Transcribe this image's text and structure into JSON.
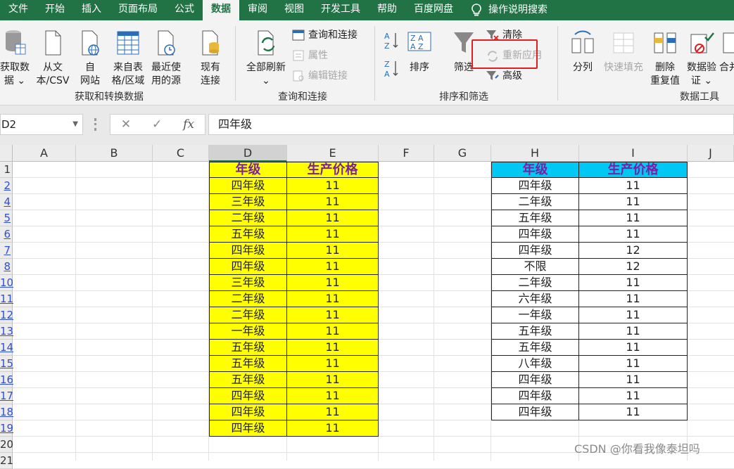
{
  "tabs": [
    "文件",
    "开始",
    "插入",
    "页面布局",
    "公式",
    "数据",
    "审阅",
    "视图",
    "开发工具",
    "帮助",
    "百度网盘",
    "操作说明搜索"
  ],
  "ribbon": {
    "get_data": [
      "获取数",
      "据 ⌄"
    ],
    "from_text": [
      "从文",
      "本/CSV"
    ],
    "from_web": [
      "自",
      "网站"
    ],
    "from_table": [
      "来自表",
      "格/区域"
    ],
    "recent": [
      "最近使",
      "用的源"
    ],
    "existing": [
      "现有",
      "连接"
    ],
    "refresh_all": [
      "全部刷新",
      "⌄"
    ],
    "queries": "查询和连接",
    "properties": "属性",
    "edit_links": "编辑链接",
    "sort": "排序",
    "filter": "筛选",
    "clear": "清除",
    "reapply": "重新应用",
    "advanced": "高级",
    "text_to_col": "分列",
    "flash_fill": "快速填充",
    "remove_dup": [
      "删除",
      "重复值"
    ],
    "validation": [
      "数据验",
      "证 ⌄"
    ],
    "consolidate": "合并",
    "groups": [
      "获取和转换数据",
      "查询和连接",
      "排序和筛选",
      "数据工具"
    ]
  },
  "formula_bar": {
    "name_box": "D2",
    "value": "四年级"
  },
  "columns": [
    "A",
    "B",
    "C",
    "D",
    "E",
    "F",
    "G",
    "H",
    "I",
    "J"
  ],
  "row_numbers": [
    "1",
    "2",
    "4",
    "5",
    "6",
    "7",
    "8",
    "10",
    "11",
    "12",
    "13",
    "14",
    "15",
    "16",
    "17",
    "18",
    "19",
    "20",
    "21"
  ],
  "table1": {
    "headers": [
      "年级",
      "生产价格"
    ],
    "rows": [
      [
        "四年级",
        "11"
      ],
      [
        "三年级",
        "11"
      ],
      [
        "二年级",
        "11"
      ],
      [
        "五年级",
        "11"
      ],
      [
        "四年级",
        "11"
      ],
      [
        "四年级",
        "11"
      ],
      [
        "三年级",
        "11"
      ],
      [
        "二年级",
        "11"
      ],
      [
        "二年级",
        "11"
      ],
      [
        "一年级",
        "11"
      ],
      [
        "五年级",
        "11"
      ],
      [
        "五年级",
        "11"
      ],
      [
        "五年级",
        "11"
      ],
      [
        "四年级",
        "11"
      ],
      [
        "四年级",
        "11"
      ],
      [
        "四年级",
        "11"
      ]
    ]
  },
  "table2": {
    "headers": [
      "年级",
      "生产价格"
    ],
    "rows": [
      [
        "四年级",
        "11"
      ],
      [
        "二年级",
        "11"
      ],
      [
        "五年级",
        "11"
      ],
      [
        "四年级",
        "11"
      ],
      [
        "四年级",
        "12"
      ],
      [
        "不限",
        "12"
      ],
      [
        "二年级",
        "11"
      ],
      [
        "六年级",
        "11"
      ],
      [
        "一年级",
        "11"
      ],
      [
        "五年级",
        "11"
      ],
      [
        "五年级",
        "11"
      ],
      [
        "八年级",
        "11"
      ],
      [
        "四年级",
        "11"
      ],
      [
        "四年级",
        "11"
      ],
      [
        "四年级",
        "11"
      ]
    ]
  },
  "watermark": "CSDN @你看我像泰坦吗",
  "colors": {
    "excel_green": "#217346",
    "yellow": "#ffff00",
    "cyan": "#00c8f5",
    "header_text": "#7a1fa2",
    "highlight": "#e02020"
  }
}
